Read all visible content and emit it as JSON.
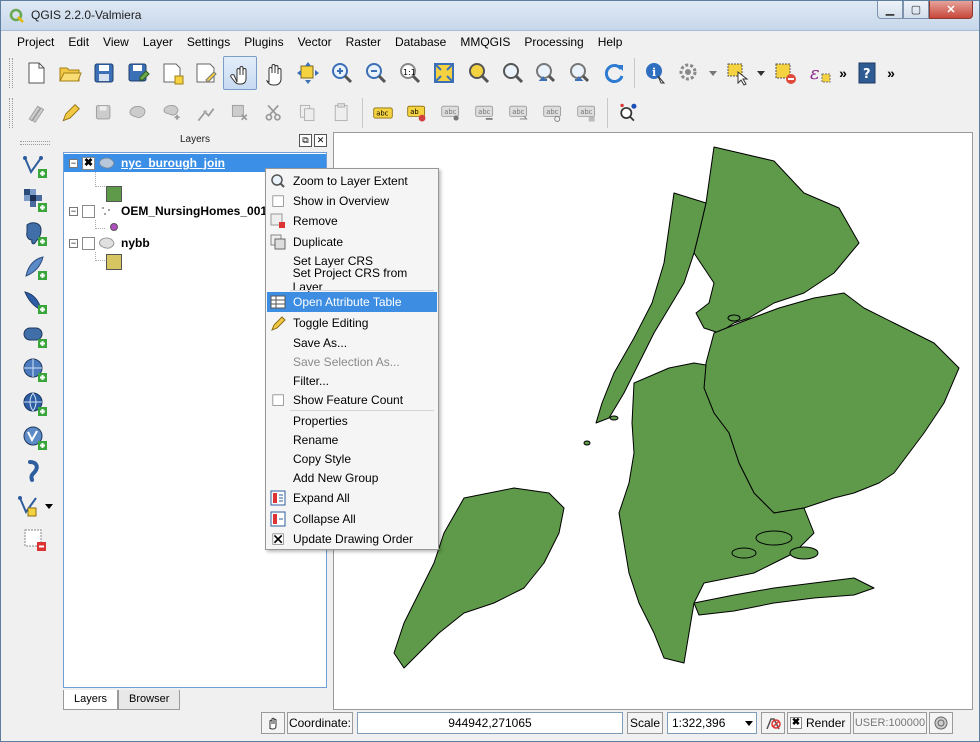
{
  "window": {
    "title": "QGIS 2.2.0-Valmiera",
    "controls": [
      "minimize",
      "maximize",
      "close"
    ]
  },
  "menubar": [
    "Project",
    "Edit",
    "View",
    "Layer",
    "Settings",
    "Plugins",
    "Vector",
    "Raster",
    "Database",
    "MMQGIS",
    "Processing",
    "Help"
  ],
  "toolbar1": [
    "new-project-icon",
    "open-project-icon",
    "save-project-icon",
    "save-as-icon",
    "new-print-composer-icon",
    "composer-manager-icon",
    "touch-zoom-icon",
    "pan-icon",
    "pan-to-selection-icon",
    "zoom-in-icon",
    "zoom-out-icon",
    "zoom-native-icon",
    "zoom-full-icon",
    "zoom-to-selection-icon",
    "zoom-to-layer-icon",
    "zoom-last-icon",
    "zoom-next-icon",
    "refresh-icon",
    "identify-icon",
    "action-icon",
    "select-icon",
    "deselect-icon",
    "field-calculator-icon",
    "help-icon"
  ],
  "toolbar2": [
    "current-edits-icon",
    "toggle-editing-icon",
    "save-edits-icon",
    "add-feature-icon",
    "move-feature-icon",
    "node-tool-icon",
    "delete-selected-icon",
    "cut-features-icon",
    "copy-features-icon",
    "paste-features-icon",
    "label-icon",
    "pin-labels-icon",
    "highlight-pinned-icon",
    "move-label-icon",
    "rotate-label-icon",
    "change-label-icon",
    "show-hide-labels-icon",
    "dbmanager-icon"
  ],
  "layers_panel": {
    "title": "Layers",
    "layers": [
      {
        "name": "nyc_burough_join",
        "checked": true,
        "selected": true,
        "legend_color": "#5e9a4a"
      },
      {
        "name": "OEM_NursingHomes_001",
        "checked": false,
        "selected": false,
        "legend_color": "#b04fbf"
      },
      {
        "name": "nybb",
        "checked": false,
        "selected": false,
        "legend_color": "#d6c560"
      }
    ],
    "tabs": [
      "Layers",
      "Browser"
    ]
  },
  "context_menu": {
    "items": [
      {
        "label": "Zoom to Layer Extent",
        "icon": "zoom-layer-icon",
        "state": "normal"
      },
      {
        "label": "Show in Overview",
        "icon": "checkbox-icon",
        "state": "normal"
      },
      {
        "label": "Remove",
        "icon": "remove-icon",
        "state": "normal"
      },
      {
        "label": "Duplicate",
        "icon": "duplicate-icon",
        "state": "normal"
      },
      {
        "label": "Set Layer CRS",
        "icon": "",
        "state": "normal"
      },
      {
        "label": "Set Project CRS from Layer",
        "icon": "",
        "state": "normal"
      },
      {
        "label": "Open Attribute Table",
        "icon": "attribute-table-icon",
        "state": "highlighted"
      },
      {
        "label": "Toggle Editing",
        "icon": "pencil-icon",
        "state": "normal"
      },
      {
        "label": "Save As...",
        "icon": "",
        "state": "normal"
      },
      {
        "label": "Save Selection As...",
        "icon": "",
        "state": "disabled"
      },
      {
        "label": "Filter...",
        "icon": "",
        "state": "normal"
      },
      {
        "label": "Show Feature Count",
        "icon": "checkbox-icon",
        "state": "normal"
      },
      {
        "label": "Properties",
        "icon": "",
        "state": "normal"
      },
      {
        "label": "Rename",
        "icon": "",
        "state": "normal"
      },
      {
        "label": "Copy Style",
        "icon": "",
        "state": "normal"
      },
      {
        "label": "Add New Group",
        "icon": "",
        "state": "normal"
      },
      {
        "label": "Expand All",
        "icon": "expand-all-icon",
        "state": "normal"
      },
      {
        "label": "Collapse All",
        "icon": "collapse-all-icon",
        "state": "normal"
      },
      {
        "label": "Update Drawing Order",
        "icon": "checked-box-icon",
        "state": "normal"
      }
    ]
  },
  "map": {
    "fill_color": "#5e9a4a",
    "stroke_color": "#000000"
  },
  "statusbar": {
    "coordinate_label": "Coordinate:",
    "coordinate_value": "944942,271065",
    "scale_label": "Scale",
    "scale_value": "1:322,396",
    "render_label": "Render",
    "render_checked": true,
    "crs_label": "USER:100000"
  }
}
